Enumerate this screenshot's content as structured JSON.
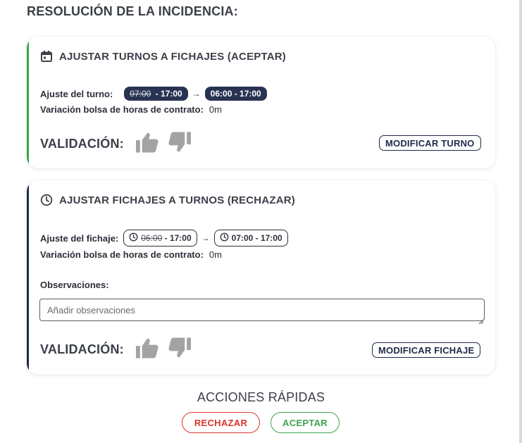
{
  "section_title": "RESOLUCIÓN DE LA INCIDENCIA:",
  "card_shift": {
    "title": "AJUSTAR TURNOS A FICHAJES (ACEPTAR)",
    "icon": "calendar-icon",
    "adjust_label": "Ajuste del turno:",
    "old_start": "07:00",
    "old_end_text": " - 17:00",
    "arrow": "→",
    "new_range": "06:00 - 17:00",
    "variation_label": "Variación bolsa de horas de contrato:",
    "variation_value": "0m",
    "validation_label": "VALIDACIÓN:",
    "modify_button": "MODIFICAR TURNO",
    "accent": "#3fa34d"
  },
  "card_clock": {
    "title": "AJUSTAR FICHAJES A TURNOS (RECHAZAR)",
    "icon": "clock-icon",
    "adjust_label": "Ajuste del fichaje:",
    "old_start": "06:00",
    "old_end_text": " - 17:00",
    "arrow": "→",
    "new_range": "07:00 - 17:00",
    "variation_label": "Variación bolsa de horas de contrato:",
    "variation_value": "0m",
    "observations_label": "Observaciones:",
    "observations_placeholder": "Añadir observaciones",
    "observations_value": "",
    "validation_label": "VALIDACIÓN:",
    "modify_button": "MODIFICAR FICHAJE",
    "accent": "#1f2a4a"
  },
  "quick_actions": {
    "title": "ACCIONES RÁPIDAS",
    "reject_label": "RECHAZAR",
    "accept_label": "ACEPTAR",
    "reject_color": "#d9362b",
    "accept_color": "#3fa34d"
  }
}
